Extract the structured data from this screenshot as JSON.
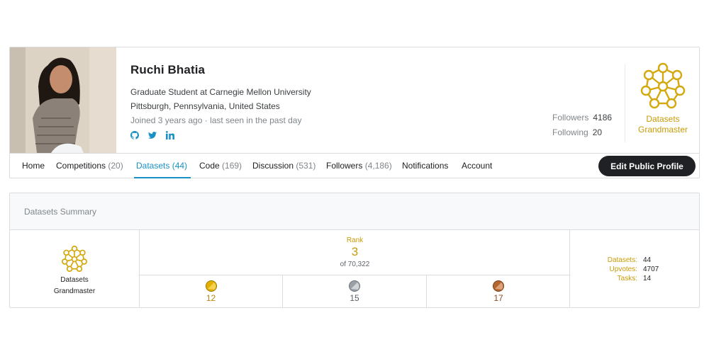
{
  "profile": {
    "name": "Ruchi Bhatia",
    "title": "Graduate Student at Carnegie Mellon University",
    "location": "Pittsburgh, Pennsylvania, United States",
    "joined": "Joined 3 years ago · last seen in the past day",
    "socials": [
      "github-icon",
      "twitter-icon",
      "linkedin-icon"
    ],
    "followers_label": "Followers",
    "followers_value": "4186",
    "following_label": "Following",
    "following_value": "20",
    "tier_line1": "Datasets",
    "tier_line2": "Grandmaster"
  },
  "tabs": [
    {
      "label": "Home",
      "count": ""
    },
    {
      "label": "Competitions",
      "count": "(20)"
    },
    {
      "label": "Datasets",
      "count": "(44)"
    },
    {
      "label": "Code",
      "count": "(169)"
    },
    {
      "label": "Discussion",
      "count": "(531)"
    },
    {
      "label": "Followers",
      "count": "(4,186)"
    },
    {
      "label": "Notifications",
      "count": ""
    },
    {
      "label": "Account",
      "count": ""
    }
  ],
  "active_tab": "Datasets",
  "edit_button": "Edit Public Profile",
  "summary": {
    "header": "Datasets Summary",
    "tier_line1": "Datasets",
    "tier_line2": "Grandmaster",
    "rank_label": "Rank",
    "rank_value": "3",
    "rank_of": "of 70,322",
    "medals": {
      "gold": "12",
      "silver": "15",
      "bronze": "17"
    },
    "stats": [
      {
        "label": "Datasets:",
        "value": "44"
      },
      {
        "label": "Upvotes:",
        "value": "4707"
      },
      {
        "label": "Tasks:",
        "value": "14"
      }
    ]
  },
  "colors": {
    "accent": "#1a91c4",
    "gold_text": "#c89b07",
    "gold_medal": "#e2b100",
    "silver_medal": "#9aa0a6",
    "bronze_medal": "#b5652e",
    "button_bg": "#202124"
  }
}
